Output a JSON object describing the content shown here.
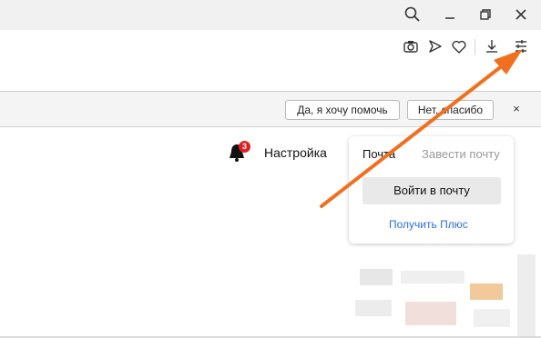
{
  "window": {
    "icons": [
      "search-icon",
      "minimize-icon",
      "restore-icon",
      "close-icon"
    ]
  },
  "toolbar": {
    "icons": [
      "camera-icon",
      "send-icon",
      "heart-icon",
      "download-icon",
      "menu-settings-icon"
    ]
  },
  "infobar": {
    "yes_label": "Да, я хочу помочь",
    "no_label": "Нет, спасибо",
    "close_glyph": "×"
  },
  "page": {
    "notifications_count": "3",
    "settings_label": "Настройка"
  },
  "mail_card": {
    "tab_mail": "Почта",
    "tab_create": "Завести почту",
    "login_label": "Войти в почту",
    "plus_link": "Получить Плюс"
  },
  "colors": {
    "accent_arrow": "#f07020",
    "badge": "#e02020",
    "link": "#2b6fd8"
  }
}
